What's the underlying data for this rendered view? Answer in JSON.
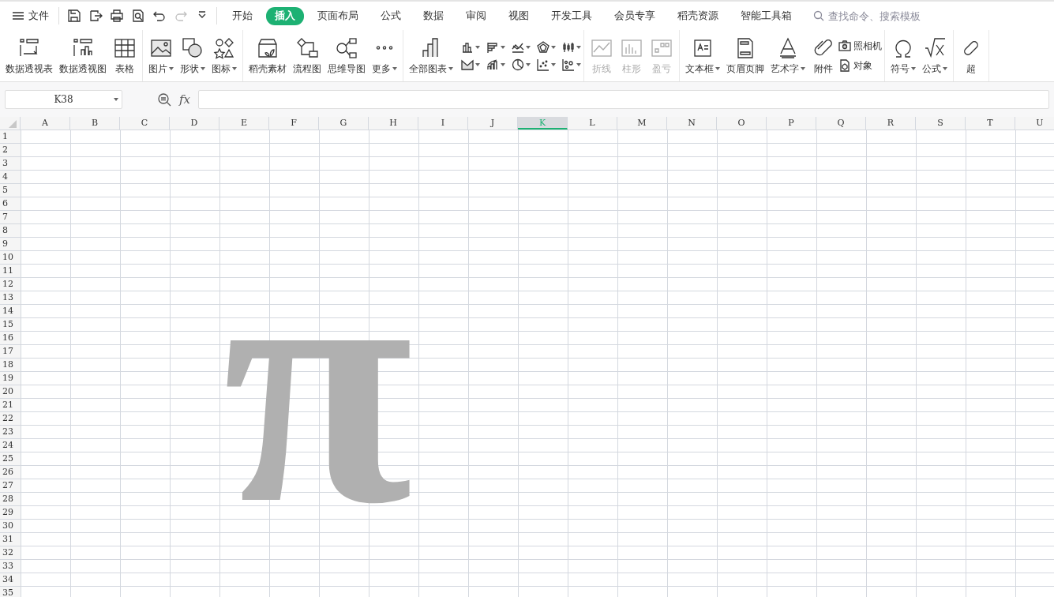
{
  "menu": {
    "label": "文件"
  },
  "quick_access": [
    {
      "disabled": false
    },
    {
      "disabled": false
    },
    {
      "disabled": false
    },
    {
      "disabled": false
    },
    {
      "disabled": false
    },
    {
      "disabled": true
    },
    {
      "disabled": false
    }
  ],
  "tabs": [
    {
      "label": "开始",
      "selected": false
    },
    {
      "label": "插入",
      "selected": true
    },
    {
      "label": "页面布局",
      "selected": false
    },
    {
      "label": "公式",
      "selected": false
    },
    {
      "label": "数据",
      "selected": false
    },
    {
      "label": "审阅",
      "selected": false
    },
    {
      "label": "视图",
      "selected": false
    },
    {
      "label": "开发工具",
      "selected": false
    },
    {
      "label": "会员专享",
      "selected": false
    },
    {
      "label": "稻壳资源",
      "selected": false
    },
    {
      "label": "智能工具箱",
      "selected": false
    }
  ],
  "search": {
    "placeholder": "查找命令、搜索模板"
  },
  "ribbon": {
    "groups": [
      {
        "items": [
          {
            "kind": "large",
            "label": "数据透视表",
            "dropdown": false,
            "disabled": false
          },
          {
            "kind": "large",
            "label": "数据透视图",
            "dropdown": false,
            "disabled": false
          },
          {
            "kind": "large",
            "label": "表格",
            "dropdown": false,
            "disabled": false
          }
        ]
      },
      {
        "items": [
          {
            "kind": "large",
            "label": "图片",
            "dropdown": true,
            "disabled": false
          },
          {
            "kind": "large",
            "label": "形状",
            "dropdown": true,
            "disabled": false
          },
          {
            "kind": "large",
            "label": "图标",
            "dropdown": true,
            "disabled": false
          }
        ]
      },
      {
        "items": [
          {
            "kind": "large",
            "label": "稻壳素材",
            "dropdown": false,
            "disabled": false
          },
          {
            "kind": "large",
            "label": "流程图",
            "dropdown": false,
            "disabled": false
          },
          {
            "kind": "large",
            "label": "思维导图",
            "dropdown": false,
            "disabled": false
          },
          {
            "kind": "large",
            "label": "更多",
            "dropdown": true,
            "disabled": false
          }
        ]
      },
      {
        "items": [
          {
            "kind": "large",
            "label": "全部图表",
            "dropdown": true,
            "disabled": false
          },
          {
            "kind": "chart-grid"
          }
        ]
      },
      {
        "items": [
          {
            "kind": "large",
            "label": "折线",
            "dropdown": false,
            "disabled": true
          },
          {
            "kind": "large",
            "label": "柱形",
            "dropdown": false,
            "disabled": true
          },
          {
            "kind": "large",
            "label": "盈亏",
            "dropdown": false,
            "disabled": true
          }
        ]
      },
      {
        "items": [
          {
            "kind": "large",
            "label": "文本框",
            "dropdown": true,
            "disabled": false
          },
          {
            "kind": "large",
            "label": "页眉页脚",
            "dropdown": false,
            "disabled": false
          },
          {
            "kind": "large",
            "label": "艺术字",
            "dropdown": true,
            "disabled": false
          },
          {
            "kind": "large",
            "label": "附件",
            "dropdown": false,
            "disabled": false
          },
          {
            "kind": "small-stack",
            "entries": [
              "照相机",
              "对象"
            ]
          }
        ]
      },
      {
        "items": [
          {
            "kind": "large",
            "label": "符号",
            "dropdown": true,
            "disabled": false
          },
          {
            "kind": "large",
            "label": "公式",
            "dropdown": true,
            "disabled": false
          }
        ]
      },
      {
        "items": [
          {
            "kind": "large",
            "label": "超",
            "dropdown": false,
            "disabled": false
          }
        ]
      }
    ]
  },
  "formula_bar": {
    "name_box": "K38",
    "fx": "fx"
  },
  "sheet": {
    "columns": [
      {
        "label": "A",
        "selected": false
      },
      {
        "label": "B",
        "selected": false
      },
      {
        "label": "C",
        "selected": false
      },
      {
        "label": "D",
        "selected": false
      },
      {
        "label": "E",
        "selected": false
      },
      {
        "label": "F",
        "selected": false
      },
      {
        "label": "G",
        "selected": false
      },
      {
        "label": "H",
        "selected": false
      },
      {
        "label": "I",
        "selected": false
      },
      {
        "label": "J",
        "selected": false
      },
      {
        "label": "K",
        "selected": true
      },
      {
        "label": "L",
        "selected": false
      },
      {
        "label": "M",
        "selected": false
      },
      {
        "label": "N",
        "selected": false
      },
      {
        "label": "O",
        "selected": false
      },
      {
        "label": "P",
        "selected": false
      },
      {
        "label": "Q",
        "selected": false
      },
      {
        "label": "R",
        "selected": false
      },
      {
        "label": "S",
        "selected": false
      },
      {
        "label": "T",
        "selected": false
      },
      {
        "label": "U",
        "selected": false
      }
    ],
    "rows": [
      "1",
      "2",
      "3",
      "4",
      "5",
      "6",
      "7",
      "8",
      "9",
      "10",
      "11",
      "12",
      "13",
      "14",
      "15",
      "16",
      "17",
      "18",
      "19",
      "20",
      "21",
      "22",
      "23",
      "24",
      "25",
      "26",
      "27",
      "28",
      "29",
      "30",
      "31",
      "32",
      "33",
      "34",
      "35"
    ],
    "floating_text": {
      "text": "π",
      "color": "#b0b0b0"
    }
  }
}
